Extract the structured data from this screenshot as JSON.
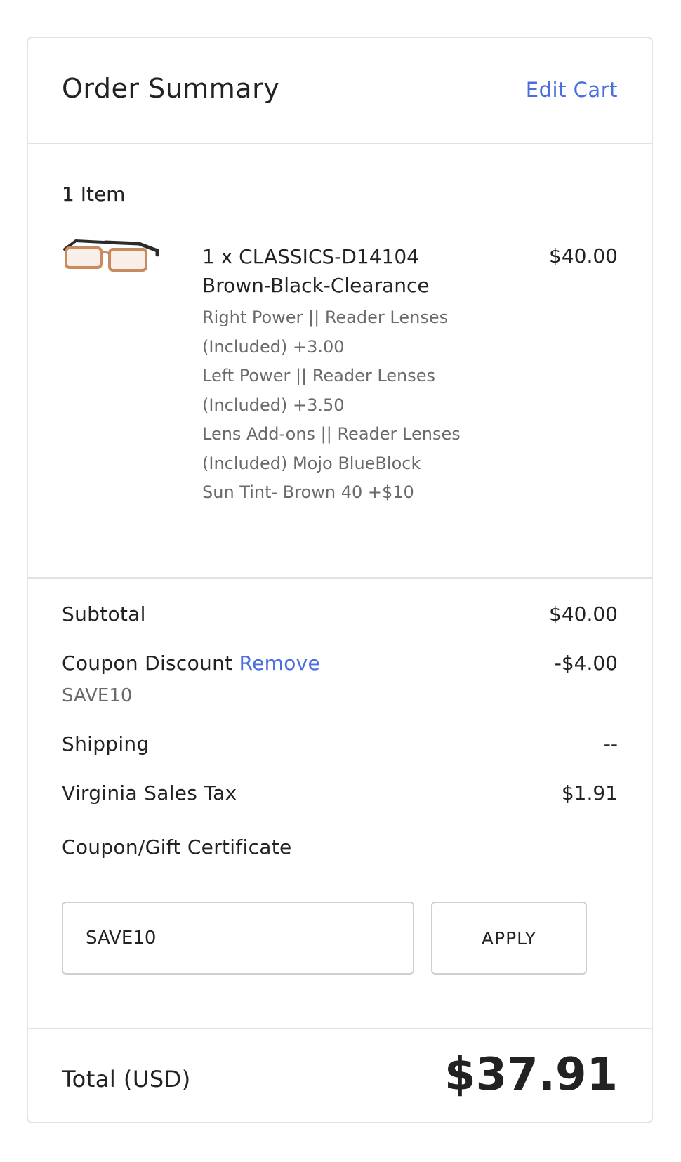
{
  "header": {
    "title": "Order Summary",
    "edit_cart_label": "Edit Cart"
  },
  "items": {
    "count_label": "1 Item",
    "list": [
      {
        "image_icon": "eyeglasses-icon",
        "name_line1": "1 x CLASSICS-D14104",
        "name_line2": "Brown-Black-Clearance",
        "price": "$40.00",
        "options": [
          "Right Power || Reader Lenses",
          "(Included) +3.00",
          "Left Power || Reader Lenses",
          "(Included) +3.50",
          "Lens Add-ons || Reader Lenses",
          "(Included) Mojo BlueBlock",
          "Sun Tint- Brown 40 +$10"
        ]
      }
    ]
  },
  "totals": {
    "subtotal_label": "Subtotal",
    "subtotal_value": "$40.00",
    "coupon_discount_label": "Coupon Discount",
    "remove_label": "Remove",
    "coupon_discount_value": "-$4.00",
    "coupon_code": "SAVE10",
    "shipping_label": "Shipping",
    "shipping_value": "--",
    "tax_label": "Virginia Sales Tax",
    "tax_value": "$1.91",
    "coupon_section_label": "Coupon/Gift Certificate",
    "coupon_input_value": "SAVE10",
    "apply_label": "APPLY"
  },
  "grand_total": {
    "label": "Total (USD)",
    "value": "$37.91"
  },
  "colors": {
    "link": "#4a6ee0",
    "border": "#e3e3e3",
    "muted_text": "#6a6a6a"
  }
}
